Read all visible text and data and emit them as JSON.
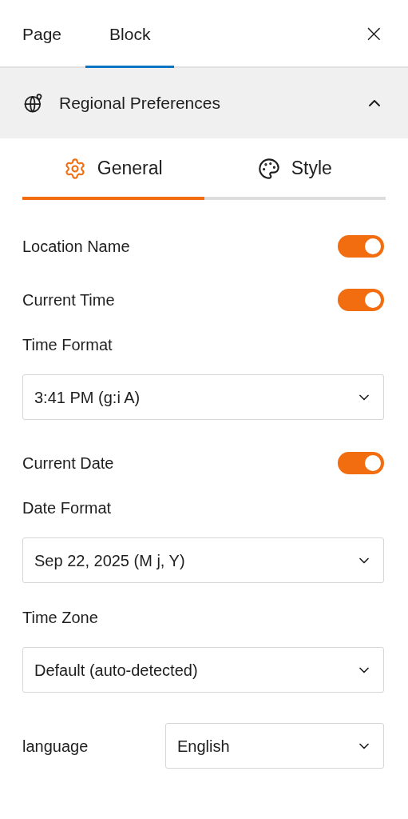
{
  "top_tabs": [
    {
      "label": "Page",
      "selected": false
    },
    {
      "label": "Block",
      "selected": true
    }
  ],
  "close": "×",
  "panel": {
    "title": "Regional Preferences",
    "expanded": true
  },
  "inner_tabs": [
    {
      "label": "General",
      "selected": true
    },
    {
      "label": "Style",
      "selected": false
    }
  ],
  "settings": [
    {
      "kind": "toggle",
      "label": "Location Name",
      "on": true
    },
    {
      "kind": "toggle",
      "label": "Current Time",
      "on": true
    },
    {
      "kind": "select",
      "label": "Time Format",
      "value": "3:41 PM (g:i A)"
    },
    {
      "kind": "toggle",
      "label": "Current Date",
      "on": true
    },
    {
      "kind": "select",
      "label": "Date Format",
      "value": "Sep 22, 2025 (M j, Y)"
    },
    {
      "kind": "select",
      "label": "Time Zone",
      "value": "Default (auto-detected)"
    },
    {
      "kind": "inline_select",
      "label": "language",
      "value": "English"
    }
  ]
}
